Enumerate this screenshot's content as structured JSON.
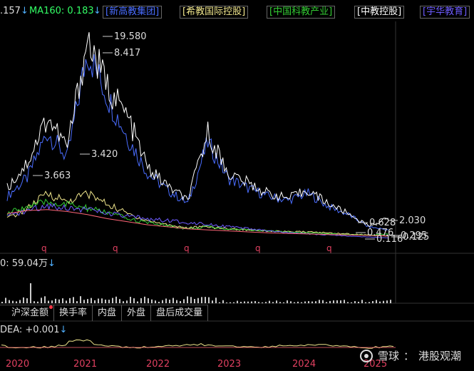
{
  "legend": {
    "ma_prev_value": ".157",
    "ma_prev_arrow": "↓",
    "ma160_label": "MA160: 0.183",
    "ma160_arrow": "↓",
    "stocks": [
      {
        "name": "[新高教集团]",
        "color": "#4a6dff"
      },
      {
        "name": "[希教国际控股]",
        "color": "#f0e68c"
      },
      {
        "name": "[中国科教产业]",
        "color": "#33cc33"
      },
      {
        "name": "[中教控股]",
        "color": "#ffffff"
      },
      {
        "name": "[宇华教育]",
        "color": "#6e5cff"
      }
    ]
  },
  "colors": {
    "arrow": "#4fb0ff",
    "ma160": "#33ff66",
    "box_border": "#666666",
    "gridline": "#2a2a2a",
    "axis_label": "#e04060",
    "q_marker": "#e04060"
  },
  "volume": {
    "label": "0: 59.04万",
    "arrow": "↓"
  },
  "tabs": [
    "沪深金额",
    "换手率",
    "内盘",
    "外盘",
    "盘后成交量"
  ],
  "indicator": {
    "label": "DEA: +0.001",
    "arrow": "↓"
  },
  "watermark": {
    "brand": "雪球",
    "separator": "：",
    "channel": "港股观潮"
  },
  "chart_data": {
    "type": "line",
    "x_labels": [
      "2020",
      "2021",
      "2022",
      "2023",
      "2024",
      "2025"
    ],
    "period_markers": [
      "q",
      "q",
      "q",
      "q",
      "q"
    ],
    "price_labels": [
      "19.580",
      "8.417",
      "3.420",
      "3.663",
      "0.628",
      "2.030",
      "0.295",
      "0.476",
      "0.116",
      "0.125"
    ],
    "series": [
      {
        "name": "新高教集团",
        "color": "#4a6dff",
        "values": [
          4.2,
          6.0,
          10.5,
          8.0,
          18.5,
          14.0,
          10.0,
          6.5,
          4.8,
          3.5,
          9.5,
          6.0,
          5.0,
          4.2,
          3.8,
          4.5,
          3.2,
          2.4,
          1.2,
          0.9
        ]
      },
      {
        "name": "中教控股",
        "color": "#ffffff",
        "values": [
          5.0,
          7.5,
          12.0,
          9.0,
          19.58,
          15.0,
          12.0,
          7.0,
          5.2,
          3.8,
          10.5,
          6.5,
          5.5,
          4.5,
          4.0,
          4.8,
          3.5,
          2.5,
          1.3,
          2.03
        ]
      },
      {
        "name": "希教国际控股",
        "color": "#f0e68c",
        "values": [
          2.0,
          3.0,
          4.5,
          3.663,
          4.5,
          3.42,
          2.5,
          1.8,
          1.4,
          1.1,
          1.2,
          1.0,
          0.9,
          0.8,
          0.7,
          0.7,
          0.6,
          0.5,
          0.4,
          0.295
        ]
      },
      {
        "name": "中国科教产业",
        "color": "#33cc33",
        "values": [
          2.5,
          3.2,
          3.6,
          3.4,
          3.0,
          2.6,
          2.0,
          1.6,
          1.3,
          1.0,
          1.2,
          1.0,
          0.9,
          0.8,
          0.7,
          0.6,
          0.5,
          0.45,
          0.4,
          0.476
        ]
      },
      {
        "name": "宇华教育",
        "color": "#6e5cff",
        "values": [
          2.2,
          2.8,
          3.3,
          3.1,
          2.9,
          2.5,
          2.2,
          2.0,
          1.8,
          1.6,
          1.5,
          1.2,
          1.0,
          0.8,
          0.6,
          0.5,
          0.4,
          0.3,
          0.2,
          0.116
        ]
      }
    ]
  }
}
